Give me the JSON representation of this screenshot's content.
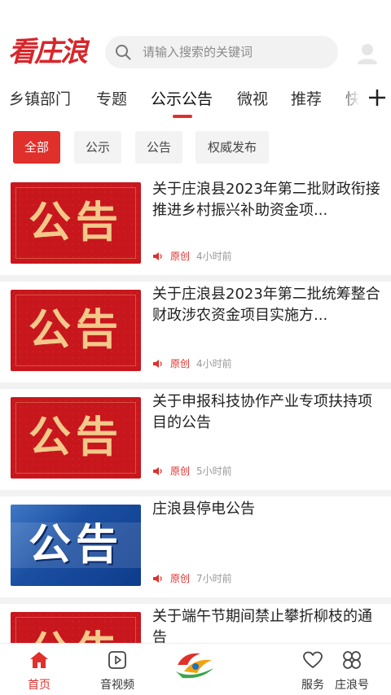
{
  "header": {
    "logo_text": "看庄浪",
    "search_placeholder": "请输入搜索的关键词",
    "search_icon": "search-icon",
    "avatar_icon": "user-avatar-icon"
  },
  "tabs": [
    {
      "label": "乡镇部门",
      "active": false
    },
    {
      "label": "专题",
      "active": false
    },
    {
      "label": "公示公告",
      "active": true
    },
    {
      "label": "微视",
      "active": false
    },
    {
      "label": "推荐",
      "active": false
    },
    {
      "label": "快讯",
      "active": false
    }
  ],
  "add_tab_icon": "plus-icon",
  "filters": [
    {
      "label": "全部",
      "active": true
    },
    {
      "label": "公示",
      "active": false
    },
    {
      "label": "公告",
      "active": false
    },
    {
      "label": "权威发布",
      "active": false
    }
  ],
  "news": [
    {
      "title": "关于庄浪县2023年第二批财政衔接推进乡村振兴补助资金项...",
      "thumb_text": "公告",
      "thumb_style": "red",
      "source": "原创",
      "time": "4小时前"
    },
    {
      "title": "关于庄浪县2023年第二批统筹整合财政涉农资金项目实施方...",
      "thumb_text": "公告",
      "thumb_style": "red",
      "source": "原创",
      "time": "4小时前"
    },
    {
      "title": "关于申报科技协作产业专项扶持项目的公告",
      "thumb_text": "公告",
      "thumb_style": "red",
      "source": "原创",
      "time": "5小时前"
    },
    {
      "title": "庄浪县停电公告",
      "thumb_text": "公告",
      "thumb_style": "blue",
      "source": "原创",
      "time": "7小时前"
    },
    {
      "title": "关于端午节期间禁止攀折柳枝的通告",
      "thumb_text": "公告",
      "thumb_style": "red",
      "source": "",
      "time": ""
    }
  ],
  "bottom_nav": [
    {
      "label": "首页",
      "icon": "home-icon",
      "active": true
    },
    {
      "label": "音视频",
      "icon": "play-icon",
      "active": false
    },
    {
      "label": "",
      "icon": "app-logo-icon",
      "active": false
    },
    {
      "label": "服务",
      "icon": "heart-icon",
      "active": false
    },
    {
      "label": "庄浪号",
      "icon": "clover-icon",
      "active": false
    }
  ],
  "colors": {
    "accent": "#e0302b",
    "tab_bg": "#f3f3f3",
    "divider": "#f2f2f2"
  }
}
